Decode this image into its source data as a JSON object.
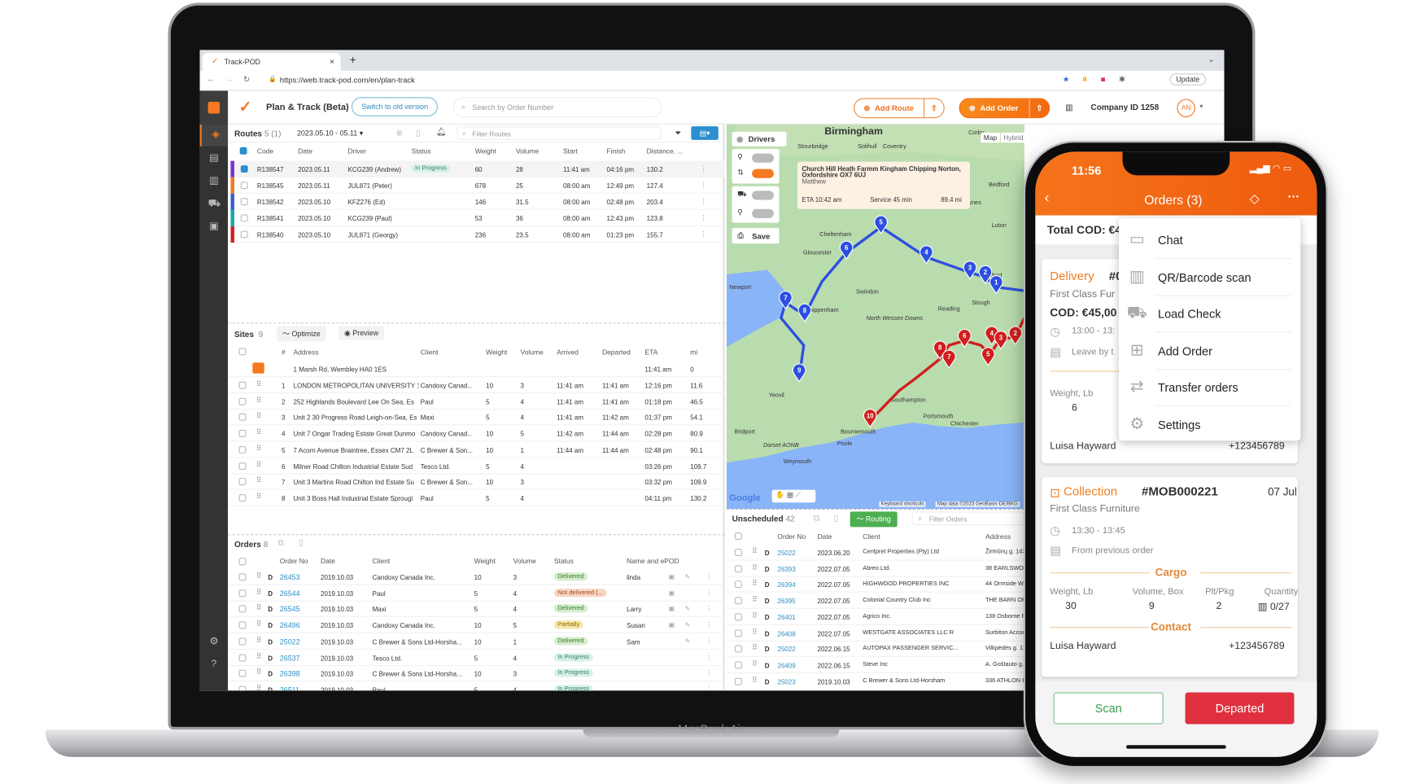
{
  "laptop_label": "MacBook Air",
  "browser": {
    "tab_title": "Track-POD",
    "new_tab": "+",
    "url": "https://web.track-pod.com/en/plan-track",
    "update": "Update"
  },
  "header": {
    "title": "Plan & Track (Beta)",
    "switch_label": "Switch to old version",
    "search_placeholder": "Search by Order Number",
    "add_route": "Add Route",
    "add_order": "Add Order",
    "company": "Company ID 1258",
    "avatar": "AN"
  },
  "colors": {
    "brand": "#f47920",
    "in_progress": "#d7f1ea",
    "delivered": "#cfe9c6",
    "not_delivered": "#f6d3c0",
    "partially": "#f7e3a6",
    "blue_route": "#2d4fe0",
    "red_route": "#d01f1f",
    "routing": "#4caf50",
    "departed": "#e0303f"
  },
  "routes": {
    "title": "Routes",
    "count": "5 (1)",
    "date_range": "2023.05.10 - 05.11",
    "filter_placeholder": "Filter Routes",
    "columns": [
      "Code",
      "Date",
      "Driver",
      "Status",
      "Weight",
      "Volume",
      "Start",
      "Finish",
      "Distance, ..."
    ],
    "rows": [
      {
        "color": "#7b2fd0",
        "checked": true,
        "cells": [
          "R138547",
          "2023.05.11",
          "KCG239 (Andrew)",
          "In Progress",
          "60",
          "28",
          "11:41 am",
          "04:16 pm",
          "130.2"
        ]
      },
      {
        "color": "#f47920",
        "checked": false,
        "cells": [
          "R138545",
          "2023.05.11",
          "JUL871 (Peter)",
          "",
          "678",
          "25",
          "08:00 am",
          "12:49 pm",
          "127.4"
        ]
      },
      {
        "color": "#3a5bd9",
        "checked": false,
        "cells": [
          "R138542",
          "2023.05.10",
          "KFZ276 (Ed)",
          "",
          "146",
          "31.5",
          "08:00 am",
          "02:48 pm",
          "203.4"
        ]
      },
      {
        "color": "#1aa6a6",
        "checked": false,
        "cells": [
          "R138541",
          "2023.05.10",
          "KCG239 (Paul)",
          "",
          "53",
          "36",
          "08:00 am",
          "12:43 pm",
          "123.8"
        ]
      },
      {
        "color": "#d42020",
        "checked": false,
        "cells": [
          "R138540",
          "2023.05.10",
          "JUL871 (Georgy)",
          "",
          "236",
          "23.5",
          "08:00 am",
          "01:23 pm",
          "155.7"
        ]
      }
    ]
  },
  "sites": {
    "title": "Sites",
    "count": "9",
    "optimize": "Optimize",
    "preview": "Preview",
    "columns": [
      "#",
      "Address",
      "Client",
      "Weight",
      "Volume",
      "Arrived",
      "Departed",
      "ETA",
      "mi"
    ],
    "depot": {
      "address": "1 Marsh Rd, Wembley HA0 1ES",
      "eta": "11:41 am",
      "mi": "0"
    },
    "rows": [
      [
        "1",
        "LONDON METROPOLITAN UNIVERSITY 1",
        "Candoxy Canad...",
        "10",
        "3",
        "11:41 am",
        "11:41 am",
        "12:16 pm",
        "11.6"
      ],
      [
        "2",
        "252 Highlands Boulevard Lee On Sea, Es",
        "Paul",
        "5",
        "4",
        "11:41 am",
        "11:41 am",
        "01:18 pm",
        "46.5"
      ],
      [
        "3",
        "Unit 2 30 Progress Road Leigh-on-Sea, Es",
        "Maxi",
        "5",
        "4",
        "11:41 am",
        "11:42 am",
        "01:37 pm",
        "54.1"
      ],
      [
        "4",
        "Unit 7 Ongar Trading Estate Great Dunmo",
        "Candoxy Canad...",
        "10",
        "5",
        "11:42 am",
        "11:44 am",
        "02:28 pm",
        "80.9"
      ],
      [
        "5",
        "7 Acorn Avenue Braintree, Essex CM7 2L",
        "C Brewer & Son...",
        "10",
        "1",
        "11:44 am",
        "11:44 am",
        "02:48 pm",
        "90.1"
      ],
      [
        "6",
        "Milner Road Chilton Industrial Estate Sud",
        "Tesco Ltd.",
        "5",
        "4",
        "",
        "",
        "03:26 pm",
        "109.7"
      ],
      [
        "7",
        "Unit 3 Martins Road Chilton Ind Estate Su",
        "C Brewer & Son...",
        "10",
        "3",
        "",
        "",
        "03:32 pm",
        "109.9"
      ],
      [
        "8",
        "Unit 3 Boss Hall Industrial Estate Sprougl",
        "Paul",
        "5",
        "4",
        "",
        "",
        "04:11 pm",
        "130.2"
      ]
    ]
  },
  "orders": {
    "title": "Orders",
    "count": "8",
    "columns": [
      "Order No",
      "Date",
      "Client",
      "Weight",
      "Volume",
      "Status",
      "Name and ePOD"
    ],
    "rows": [
      {
        "type": "D",
        "no": "26453",
        "date": "2019.10.03",
        "client": "Candoxy Canada Inc.",
        "weight": "10",
        "volume": "3",
        "status": "Delivered",
        "status_kind": "delivered",
        "name": "linda"
      },
      {
        "type": "D",
        "no": "26544",
        "date": "2019.10.03",
        "client": "Paul",
        "weight": "5",
        "volume": "4",
        "status": "Not delivered (...",
        "status_kind": "not_delivered",
        "name": ""
      },
      {
        "type": "D",
        "no": "26545",
        "date": "2019.10.03",
        "client": "Maxi",
        "weight": "5",
        "volume": "4",
        "status": "Delivered",
        "status_kind": "delivered",
        "name": "Larry"
      },
      {
        "type": "D",
        "no": "26496",
        "date": "2019.10.03",
        "client": "Candoxy Canada Inc.",
        "weight": "10",
        "volume": "5",
        "status": "Partially",
        "status_kind": "partially",
        "name": "Susan"
      },
      {
        "type": "D",
        "no": "25022",
        "date": "2019.10.03",
        "client": "C Brewer & Sons Ltd-Horsha...",
        "weight": "10",
        "volume": "1",
        "status": "Delivered",
        "status_kind": "delivered",
        "name": "Sam"
      },
      {
        "type": "D",
        "no": "26537",
        "date": "2019.10.03",
        "client": "Tesco Ltd.",
        "weight": "5",
        "volume": "4",
        "status": "In Progress",
        "status_kind": "in_progress",
        "name": ""
      },
      {
        "type": "D",
        "no": "26398",
        "date": "2019.10.03",
        "client": "C Brewer & Sons Ltd-Horsha...",
        "weight": "10",
        "volume": "3",
        "status": "In Progress",
        "status_kind": "in_progress",
        "name": ""
      },
      {
        "type": "D",
        "no": "26511",
        "date": "2019.10.03",
        "client": "Paul",
        "weight": "5",
        "volume": "4",
        "status": "In Progress",
        "status_kind": "in_progress",
        "name": ""
      }
    ]
  },
  "unscheduled": {
    "title": "Unscheduled",
    "count": "42",
    "routing": "Routing",
    "filter_placeholder": "Filter Orders",
    "columns": [
      "Order No",
      "Date",
      "Client",
      "Address"
    ],
    "rows": [
      {
        "type": "D",
        "no": "25022",
        "date": "2023.06.20",
        "client": "Centpret Properties (Pty) Ltd",
        "address": "Žirmūnų g. 143"
      },
      {
        "type": "D",
        "no": "26393",
        "date": "2022.07.05",
        "client": "Abreo Ltd.",
        "address": "38 EARLSWOOD"
      },
      {
        "type": "D",
        "no": "26394",
        "date": "2022.07.05",
        "client": "HIGHWOOD PROPERTIES INC",
        "address": "44 Ormside Way"
      },
      {
        "type": "D",
        "no": "26395",
        "date": "2022.07.05",
        "client": "Colonial Country Club Inc",
        "address": "THE BARN ORC"
      },
      {
        "type": "D",
        "no": "26401",
        "date": "2022.07.05",
        "client": "Agrico Inc.",
        "address": "138 Osborne Ro"
      },
      {
        "type": "D",
        "no": "26408",
        "date": "2022.07.05",
        "client": "WESTGATE ASSOCIATES LLC R",
        "address": "Surbiton Accoun"
      },
      {
        "type": "D",
        "no": "25022",
        "date": "2022.06.15",
        "client": "AUTOPAX PASSENGER SERVIC...",
        "address": "Vilkpėdės g. 12,"
      },
      {
        "type": "D",
        "no": "26409",
        "date": "2022.06.15",
        "client": "Steve Inc",
        "address": "A. Goštauto g. 1"
      },
      {
        "type": "D",
        "no": "25023",
        "date": "2019.10.03",
        "client": "C Brewer & Sons Ltd-Horsham",
        "address": "336 ATHLON RO"
      }
    ]
  },
  "map": {
    "drivers": "Drivers",
    "save": "Save",
    "map_types": [
      "Map",
      "Hybrid"
    ],
    "tooltip": {
      "address": "Church Hill Heath Farmm Kingham Chipping Norton, Oxfordshire OX7 6UJ",
      "driver": "Matthew",
      "eta": "ETA 10:42 am",
      "service": "Service 45 min",
      "distance": "89.4 mi"
    },
    "places": [
      "Birmingham",
      "Stourbridge",
      "Solihull",
      "Coventry",
      "Corby",
      "Bedford",
      "Milton Keynes",
      "Luton",
      "Cheltenham",
      "Gloucester",
      "Swindon",
      "Newport",
      "Chippenham",
      "Reading",
      "Slough",
      "Watford",
      "North Wessex Downs",
      "Yeovil",
      "Bridport",
      "Dorset AONB",
      "Bournemouth",
      "Poole",
      "Weymouth",
      "Southampton",
      "Portsmouth",
      "Chichester"
    ],
    "blue_pins": [
      "5",
      "4",
      "3",
      "2",
      "1",
      "6",
      "7",
      "8",
      "9"
    ],
    "red_pins": [
      "10",
      "8",
      "7",
      "6",
      "5",
      "4",
      "3",
      "2"
    ],
    "google": "Google",
    "shortcuts": "Keyboard shortcuts",
    "attribution": "Map data ©2023 GeoBasis-DE/BKG"
  },
  "phone": {
    "time": "11:56",
    "title": "Orders (3)",
    "total_cod": "Total COD: €4",
    "menu": [
      "Chat",
      "QR/Barcode scan",
      "Load Check",
      "Add Order",
      "Transfer orders",
      "Settings"
    ],
    "card1": {
      "type": "Delivery",
      "number": "#0",
      "client": "First Class Fur",
      "cod": "COD: €45,00",
      "time": "13:00 - 13:",
      "note": "Leave by t",
      "weight_label": "Weight, Lb",
      "weight": "6",
      "contact": "Luisa Hayward",
      "phone": "+123456789"
    },
    "card2": {
      "type": "Collection",
      "number": "#MOB000221",
      "date": "07 Jul",
      "client": "First Class Furniture",
      "time": "13:30 - 13:45",
      "note": "From previous order",
      "cargo": "Cargo",
      "weight_label": "Weight, Lb",
      "weight": "30",
      "volume_label": "Volume, Box",
      "volume": "9",
      "plt_label": "Plt/Pkg",
      "plt": "2",
      "qty_label": "Quantity",
      "qty": "0/27",
      "contact_heading": "Contact",
      "contact": "Luisa Hayward",
      "phone": "+123456789"
    },
    "scan": "Scan",
    "departed": "Departed"
  }
}
